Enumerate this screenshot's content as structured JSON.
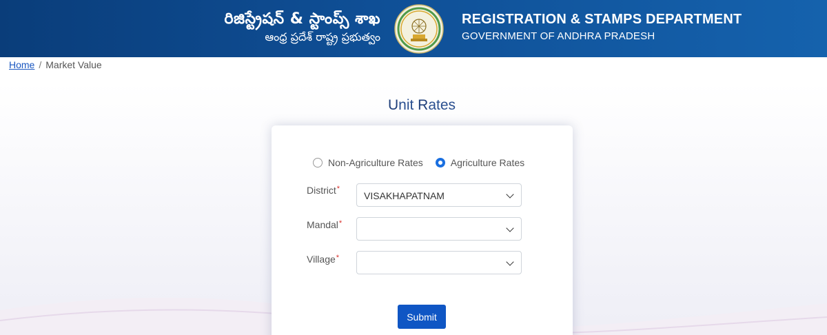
{
  "header": {
    "telugu_title": "రిజిస్ట్రేషన్ & స్టాంప్స్ శాఖ",
    "telugu_subtitle": "ఆంధ్ర ప్రదేశ్ రాష్ట్ర ప్రభుత్వం",
    "english_title": "REGISTRATION & STAMPS DEPARTMENT",
    "english_subtitle": "GOVERNMENT OF ANDHRA PRADESH",
    "emblem_icon": "state-emblem-icon"
  },
  "breadcrumb": {
    "home": "Home",
    "separator": "/",
    "current": "Market Value"
  },
  "page": {
    "title_part1": "U",
    "title_part2": "nit ",
    "title_part3": "R",
    "title_part4": "ates"
  },
  "form": {
    "rate_types": [
      {
        "label": "Non-Agriculture Rates",
        "selected": false
      },
      {
        "label": "Agriculture Rates",
        "selected": true
      }
    ],
    "fields": [
      {
        "label": "District",
        "required_mark": "*",
        "value": ""
      },
      {
        "label": "Mandal",
        "required_mark": "*",
        "value": ""
      },
      {
        "label": "Village",
        "required_mark": "*",
        "value": ""
      }
    ],
    "district_value": "VISAKHAPATNAM",
    "submit_label": "Submit"
  },
  "colors": {
    "header_bg": "#0f4f96",
    "accent": "#0f56c4",
    "required": "#d9302c"
  }
}
